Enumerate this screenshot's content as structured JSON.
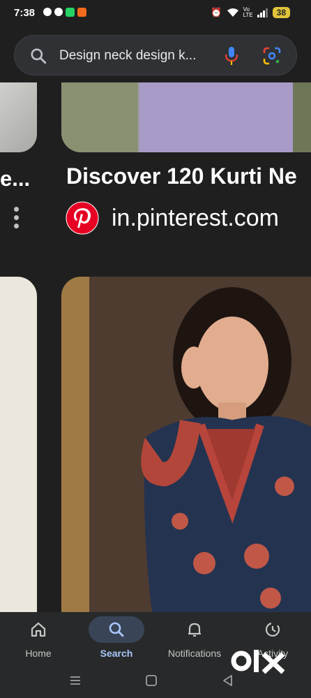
{
  "status_bar": {
    "time": "7:38",
    "battery": "38",
    "icons": [
      "snapchat-icon",
      "c-icon",
      "whatsapp-icon",
      "app-icon",
      "alarm-icon",
      "wifi-icon",
      "volte-icon",
      "signal-icon",
      "battery-icon"
    ]
  },
  "search": {
    "query": "Design neck design k..."
  },
  "results": {
    "left_title_fragment": "e...",
    "title": "Discover 120 Kurti Ne",
    "source": "in.pinterest.com"
  },
  "bottom_nav": {
    "items": [
      {
        "label": "Home",
        "icon": "home-icon"
      },
      {
        "label": "Search",
        "icon": "search-icon",
        "active": true
      },
      {
        "label": "Notifications",
        "icon": "bell-icon"
      },
      {
        "label": "Activity",
        "icon": "activity-icon"
      }
    ]
  },
  "colors": {
    "background": "#1f1f1f",
    "nav_background": "#28292a",
    "accent": "#a8c7fa",
    "pinterest_red": "#e60023"
  }
}
